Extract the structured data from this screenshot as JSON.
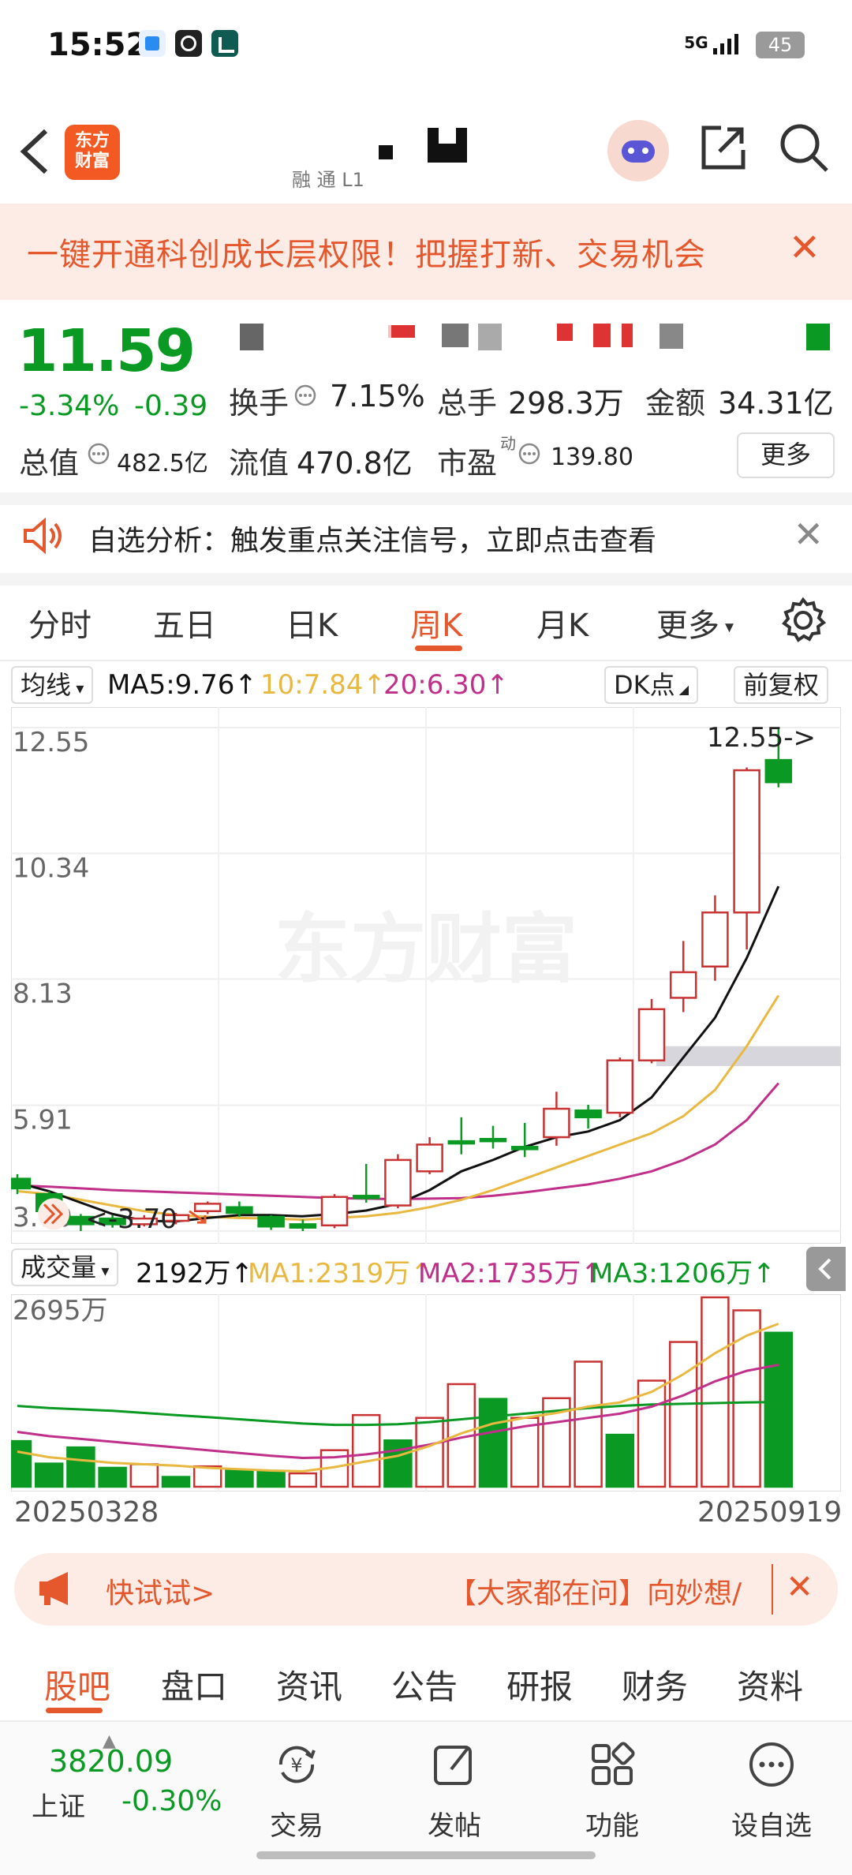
{
  "status_bar": {
    "time": "15:52",
    "network": "5G",
    "battery": "45"
  },
  "nav": {
    "logo_text": "东方\n财富",
    "sub_title": "融 通 L1"
  },
  "banner": {
    "text": "一键开通科创成长层权限！把握打新、交易机会",
    "close": "✕"
  },
  "quote": {
    "price": "11.59",
    "change_pct": "-3.34%",
    "change_amt": "-0.39",
    "turnover_label": "换手",
    "turnover": "7.15%",
    "volume_label": "总手",
    "volume": "298.3万",
    "amount_label": "金额",
    "amount": "34.31亿",
    "mktcap_label": "总值",
    "mktcap": "482.5亿",
    "float_label": "流值",
    "float_cap": "470.8亿",
    "pe_label": "市盈",
    "pe_sup": "动",
    "pe": "139.80",
    "more_label": "更多"
  },
  "alert": {
    "text": "自选分析：触发重点关注信号，立即点击查看",
    "close": "✕"
  },
  "tabs": [
    "分时",
    "五日",
    "日K",
    "周K",
    "月K",
    "更多"
  ],
  "active_tab": "周K",
  "ma_row": {
    "selector": "均线",
    "ma5": "MA5:9.76",
    "ma10": "10:7.84",
    "ma20": "20:6.30",
    "dk": "DK点",
    "adjust": "前复权"
  },
  "colors": {
    "accent": "#e5572c",
    "up": "#c83232",
    "down": "#0a9a24",
    "ma5": "#111111",
    "ma10": "#e8b840",
    "ma20": "#c0308a"
  },
  "chart_data": [
    {
      "type": "candlestick",
      "y_ticks": [
        "12.55",
        "10.34",
        "8.13",
        "5.91",
        "3.70"
      ],
      "ylim": [
        3.7,
        12.55
      ],
      "high_label": "12.55->",
      "low_label": "<-3.70",
      "watermark": "东方财富",
      "candles": [
        {
          "o": 4.62,
          "c": 4.45,
          "h": 4.7,
          "l": 4.35
        },
        {
          "o": 4.35,
          "c": 4.05,
          "h": 4.4,
          "l": 3.95
        },
        {
          "o": 3.95,
          "c": 3.82,
          "h": 4.0,
          "l": 3.7
        },
        {
          "o": 3.92,
          "c": 3.82,
          "h": 3.98,
          "l": 3.76
        },
        {
          "o": 3.82,
          "c": 3.92,
          "h": 3.98,
          "l": 3.78
        },
        {
          "o": 3.88,
          "c": 3.98,
          "h": 4.02,
          "l": 3.82
        },
        {
          "o": 4.05,
          "c": 4.18,
          "h": 4.22,
          "l": 4.0
        },
        {
          "o": 4.12,
          "c": 4.02,
          "h": 4.22,
          "l": 3.95
        },
        {
          "o": 3.95,
          "c": 3.78,
          "h": 3.98,
          "l": 3.72
        },
        {
          "o": 3.82,
          "c": 3.76,
          "h": 3.9,
          "l": 3.7
        },
        {
          "o": 3.8,
          "c": 4.3,
          "h": 4.35,
          "l": 3.75
        },
        {
          "o": 4.32,
          "c": 4.32,
          "h": 4.88,
          "l": 4.2
        },
        {
          "o": 4.15,
          "c": 4.95,
          "h": 5.05,
          "l": 4.1
        },
        {
          "o": 4.75,
          "c": 5.22,
          "h": 5.35,
          "l": 4.7
        },
        {
          "o": 5.28,
          "c": 5.28,
          "h": 5.7,
          "l": 5.05
        },
        {
          "o": 5.32,
          "c": 5.32,
          "h": 5.55,
          "l": 5.15
        },
        {
          "o": 5.18,
          "c": 5.18,
          "h": 5.6,
          "l": 5.0
        },
        {
          "o": 5.35,
          "c": 5.85,
          "h": 6.15,
          "l": 5.2
        },
        {
          "o": 5.82,
          "c": 5.7,
          "h": 5.92,
          "l": 5.5
        },
        {
          "o": 5.78,
          "c": 6.7,
          "h": 6.75,
          "l": 5.7
        },
        {
          "o": 6.7,
          "c": 7.6,
          "h": 7.78,
          "l": 6.65
        },
        {
          "o": 7.8,
          "c": 8.25,
          "h": 8.8,
          "l": 7.55
        },
        {
          "o": 8.35,
          "c": 9.3,
          "h": 9.6,
          "l": 8.1
        },
        {
          "o": 9.3,
          "c": 11.8,
          "h": 11.85,
          "l": 8.65
        },
        {
          "o": 11.98,
          "c": 11.59,
          "h": 12.55,
          "l": 11.5
        }
      ],
      "ma5": [
        4.55,
        4.4,
        4.2,
        4.0,
        3.88,
        3.87,
        3.93,
        3.98,
        3.98,
        3.96,
        4.0,
        4.06,
        4.18,
        4.42,
        4.75,
        4.95,
        5.18,
        5.35,
        5.45,
        5.65,
        6.05,
        6.75,
        7.45,
        8.5,
        9.76
      ],
      "ma10": [
        4.4,
        4.35,
        4.25,
        4.15,
        4.05,
        3.98,
        3.95,
        3.93,
        3.92,
        3.9,
        3.93,
        3.96,
        4.02,
        4.12,
        4.25,
        4.42,
        4.62,
        4.82,
        5.02,
        5.22,
        5.42,
        5.72,
        6.18,
        6.95,
        7.84
      ],
      "ma20": [
        4.5,
        4.48,
        4.45,
        4.42,
        4.4,
        4.38,
        4.36,
        4.34,
        4.32,
        4.3,
        4.28,
        4.27,
        4.26,
        4.27,
        4.28,
        4.32,
        4.38,
        4.45,
        4.52,
        4.62,
        4.75,
        4.95,
        5.22,
        5.65,
        6.3
      ]
    },
    {
      "type": "bar",
      "y_tick": "2695万",
      "ylim": [
        0,
        2695
      ],
      "start_date": "20250328",
      "end_date": "20250919",
      "bars": [
        {
          "v": 650,
          "up": false
        },
        {
          "v": 330,
          "up": false
        },
        {
          "v": 560,
          "up": false
        },
        {
          "v": 270,
          "up": false
        },
        {
          "v": 320,
          "up": true
        },
        {
          "v": 140,
          "up": false
        },
        {
          "v": 290,
          "up": true
        },
        {
          "v": 230,
          "up": false
        },
        {
          "v": 220,
          "up": false
        },
        {
          "v": 190,
          "up": true
        },
        {
          "v": 520,
          "up": true
        },
        {
          "v": 1020,
          "up": true
        },
        {
          "v": 660,
          "up": false
        },
        {
          "v": 980,
          "up": true
        },
        {
          "v": 1460,
          "up": true
        },
        {
          "v": 1250,
          "up": false
        },
        {
          "v": 980,
          "up": true
        },
        {
          "v": 1260,
          "up": true
        },
        {
          "v": 1780,
          "up": true
        },
        {
          "v": 740,
          "up": false
        },
        {
          "v": 1510,
          "up": true
        },
        {
          "v": 2060,
          "up": true
        },
        {
          "v": 2695,
          "up": true
        },
        {
          "v": 2510,
          "up": true
        },
        {
          "v": 2192,
          "up": false
        }
      ],
      "ma1": [
        500,
        420,
        380,
        340,
        320,
        300,
        270,
        250,
        230,
        220,
        280,
        360,
        440,
        580,
        760,
        900,
        980,
        1050,
        1140,
        1200,
        1350,
        1600,
        1900,
        2150,
        2319
      ],
      "ma2": [
        780,
        720,
        680,
        640,
        600,
        560,
        520,
        480,
        440,
        410,
        420,
        460,
        520,
        600,
        700,
        780,
        860,
        920,
        980,
        1040,
        1140,
        1300,
        1500,
        1650,
        1735
      ],
      "ma3": [
        1150,
        1120,
        1100,
        1080,
        1050,
        1020,
        990,
        960,
        930,
        900,
        880,
        880,
        890,
        920,
        960,
        1000,
        1040,
        1080,
        1120,
        1150,
        1170,
        1180,
        1190,
        1200,
        1206
      ]
    }
  ],
  "vol_row": {
    "selector": "成交量",
    "current": "2192万",
    "ma1": "MA1:2319万",
    "ma2": "MA2:1735万",
    "ma3": "MA3:1206万"
  },
  "promo": {
    "quick": "快试试>",
    "question": "【大家都在问】向妙想/",
    "close": "✕"
  },
  "footer_tabs": [
    "股吧",
    "盘口",
    "资讯",
    "公告",
    "研报",
    "财务",
    "资料"
  ],
  "bottom_bar": {
    "index_value": "3820.09",
    "index_name": "上证",
    "index_change": "-0.30%",
    "items": [
      "交易",
      "发帖",
      "功能",
      "设自选"
    ]
  }
}
